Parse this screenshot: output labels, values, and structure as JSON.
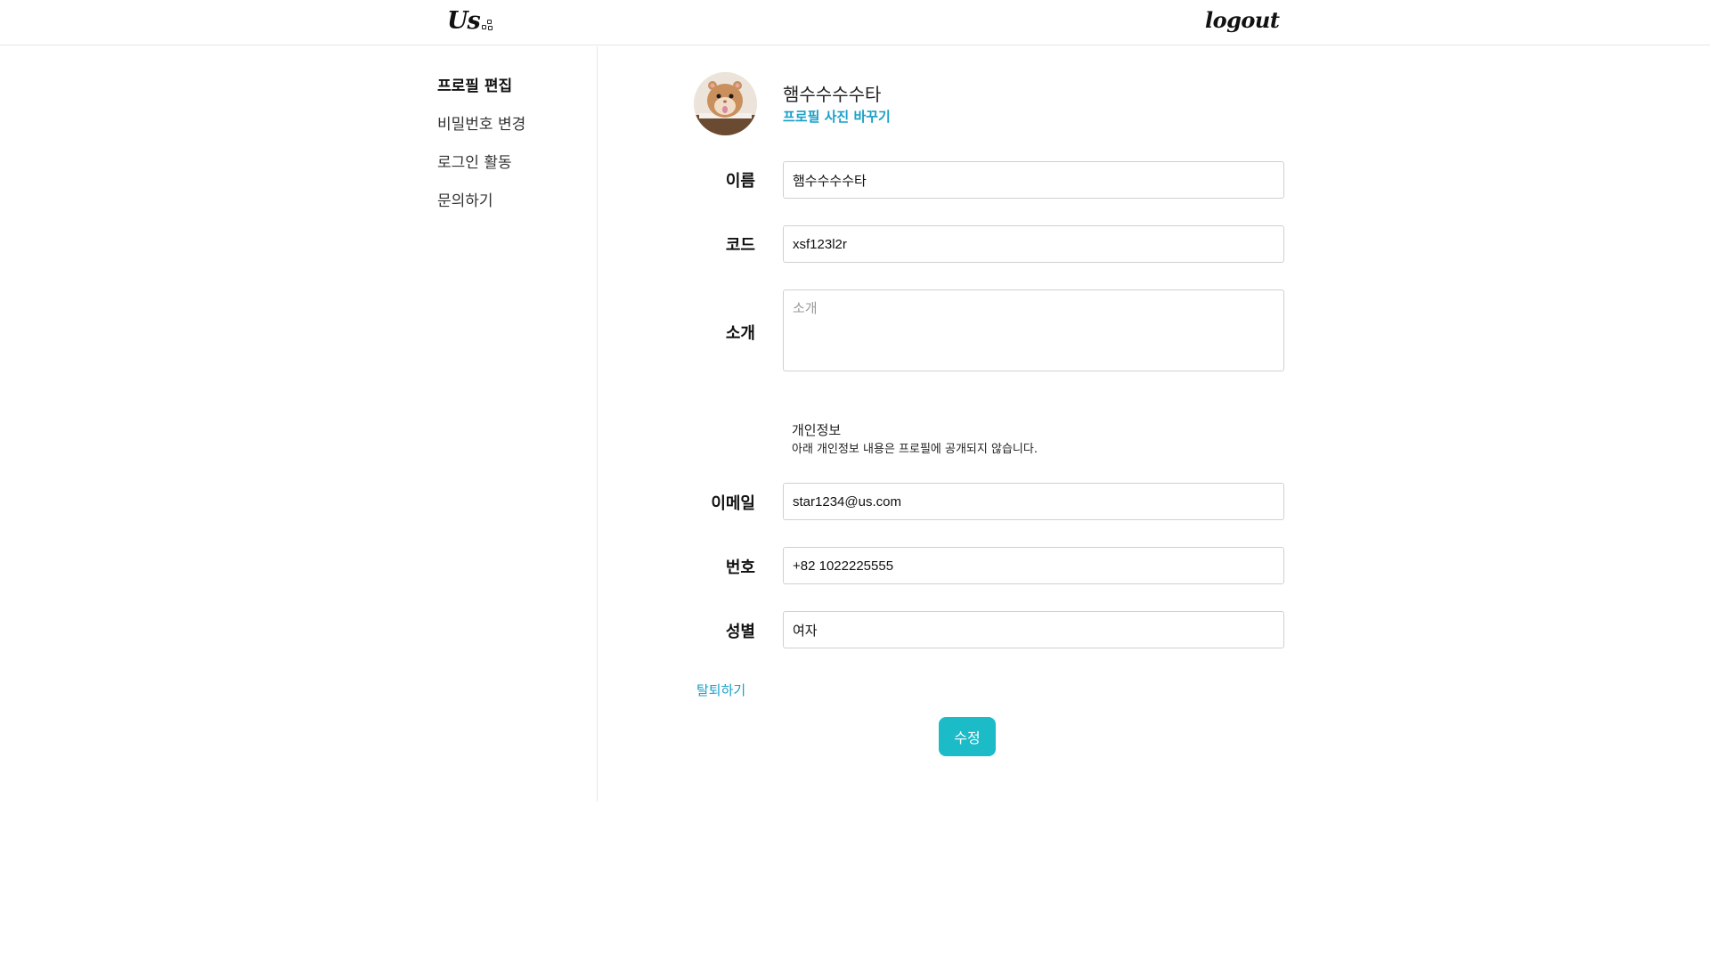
{
  "header": {
    "logo_text": "Us",
    "logout_label": "logout"
  },
  "sidebar": {
    "items": [
      {
        "label": "프로필 편집",
        "active": true
      },
      {
        "label": "비밀번호 변경",
        "active": false
      },
      {
        "label": "로그인 활동",
        "active": false
      },
      {
        "label": "문의하기",
        "active": false
      }
    ]
  },
  "profile": {
    "name": "햄수수수수타",
    "change_photo_label": "프로필 사진 바꾸기",
    "avatar_icon": "hamster-avatar"
  },
  "form": {
    "name": {
      "label": "이름",
      "value": "햄수수수수타"
    },
    "code": {
      "label": "코드",
      "value": "xsf123l2r"
    },
    "intro": {
      "label": "소개",
      "value": "",
      "placeholder": "소개"
    },
    "privacy_title": "개인정보",
    "privacy_desc": "아래 개인정보 내용은 프로필에 공개되지 않습니다.",
    "email": {
      "label": "이메일",
      "value": "star1234@us.com"
    },
    "phone": {
      "label": "번호",
      "value": "+82 1022225555"
    },
    "gender": {
      "label": "성별",
      "value": "여자"
    },
    "withdraw_label": "탈퇴하기",
    "submit_label": "수정"
  },
  "colors": {
    "accent": "#1bbcc8",
    "link": "#1aa0c9",
    "border": "#d0d0d0"
  }
}
